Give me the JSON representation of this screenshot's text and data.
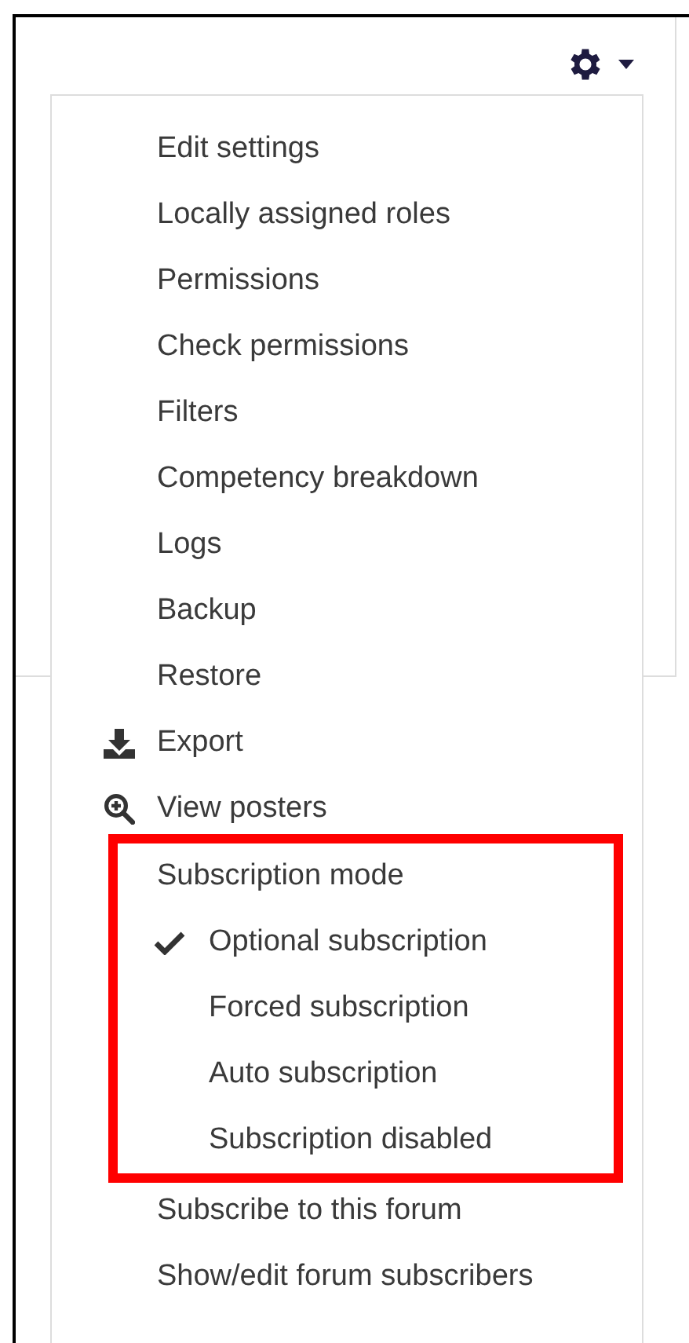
{
  "menu": {
    "items": [
      {
        "label": "Edit settings",
        "kind": "plain"
      },
      {
        "label": "Locally assigned roles",
        "kind": "plain"
      },
      {
        "label": "Permissions",
        "kind": "plain"
      },
      {
        "label": "Check permissions",
        "kind": "plain"
      },
      {
        "label": "Filters",
        "kind": "plain"
      },
      {
        "label": "Competency breakdown",
        "kind": "plain"
      },
      {
        "label": "Logs",
        "kind": "plain"
      },
      {
        "label": "Backup",
        "kind": "plain"
      },
      {
        "label": "Restore",
        "kind": "plain"
      },
      {
        "label": "Export",
        "kind": "download"
      },
      {
        "label": "View posters",
        "kind": "zoom"
      }
    ],
    "subscription": {
      "heading": "Subscription mode",
      "highlighted": true,
      "options": [
        {
          "label": "Optional subscription",
          "selected": true
        },
        {
          "label": "Forced subscription",
          "selected": false
        },
        {
          "label": "Auto subscription",
          "selected": false
        },
        {
          "label": "Subscription disabled",
          "selected": false
        }
      ]
    },
    "footer_items": [
      {
        "label": "Subscribe to this forum"
      },
      {
        "label": "Show/edit forum subscribers"
      }
    ]
  }
}
